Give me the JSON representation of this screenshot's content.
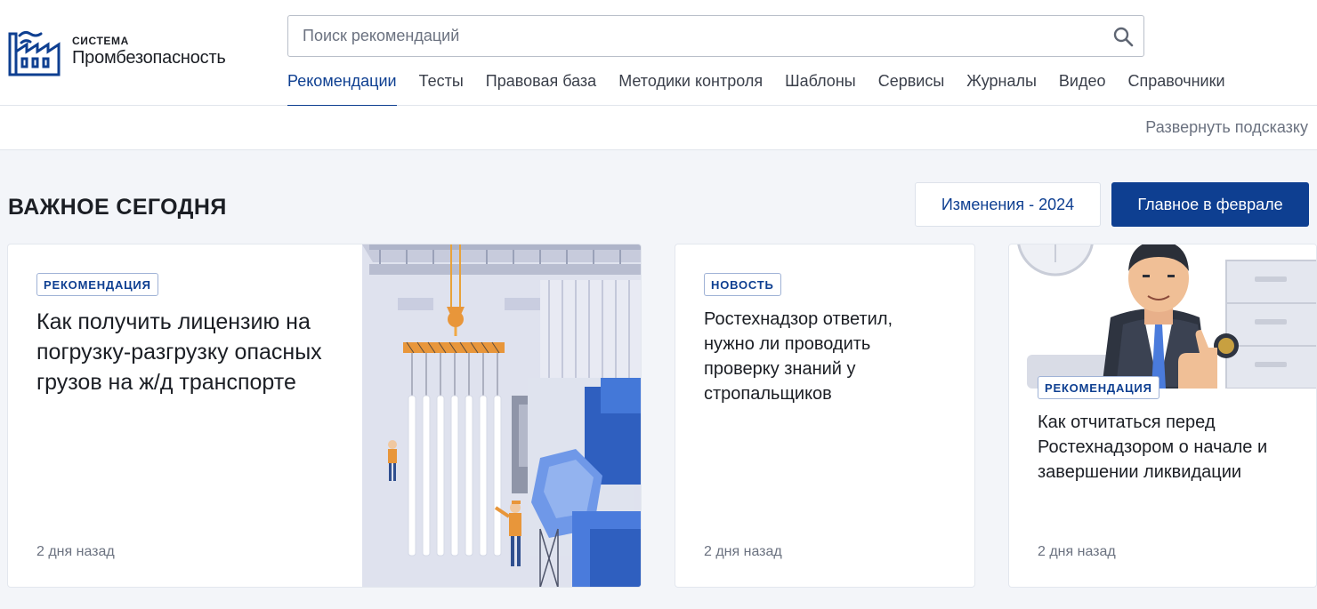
{
  "logo": {
    "small": "СИСТЕМА",
    "big": "Промбезопасность"
  },
  "search": {
    "placeholder": "Поиск рекомендаций"
  },
  "nav": [
    {
      "label": "Рекомендации",
      "active": true
    },
    {
      "label": "Тесты"
    },
    {
      "label": "Правовая база"
    },
    {
      "label": "Методики контроля"
    },
    {
      "label": "Шаблоны"
    },
    {
      "label": "Сервисы"
    },
    {
      "label": "Журналы"
    },
    {
      "label": "Видео"
    },
    {
      "label": "Справочники"
    }
  ],
  "hint": {
    "label": "Развернуть подсказку"
  },
  "section": {
    "title": "ВАЖНОЕ СЕГОДНЯ",
    "btn_changes": "Изменения - 2024",
    "btn_main": "Главное в феврале"
  },
  "cards": [
    {
      "badge": "РЕКОМЕНДАЦИЯ",
      "title": "Как получить лицензию на погрузку-разгрузку опасных грузов на ж/д транспорте",
      "date": "2 дня назад"
    },
    {
      "badge": "НОВОСТЬ",
      "title": "Ростехнадзор ответил, нужно ли проводить проверку знаний у стропальщиков",
      "date": "2 дня назад"
    },
    {
      "badge": "РЕКОМЕНДАЦИЯ",
      "title": "Как отчитаться перед Ростехнадзором о начале и завершении ликвидации",
      "date": "2 дня назад"
    }
  ],
  "colors": {
    "brand": "#0e3f91",
    "background": "#f3f5f9",
    "muted": "#6b7280"
  }
}
